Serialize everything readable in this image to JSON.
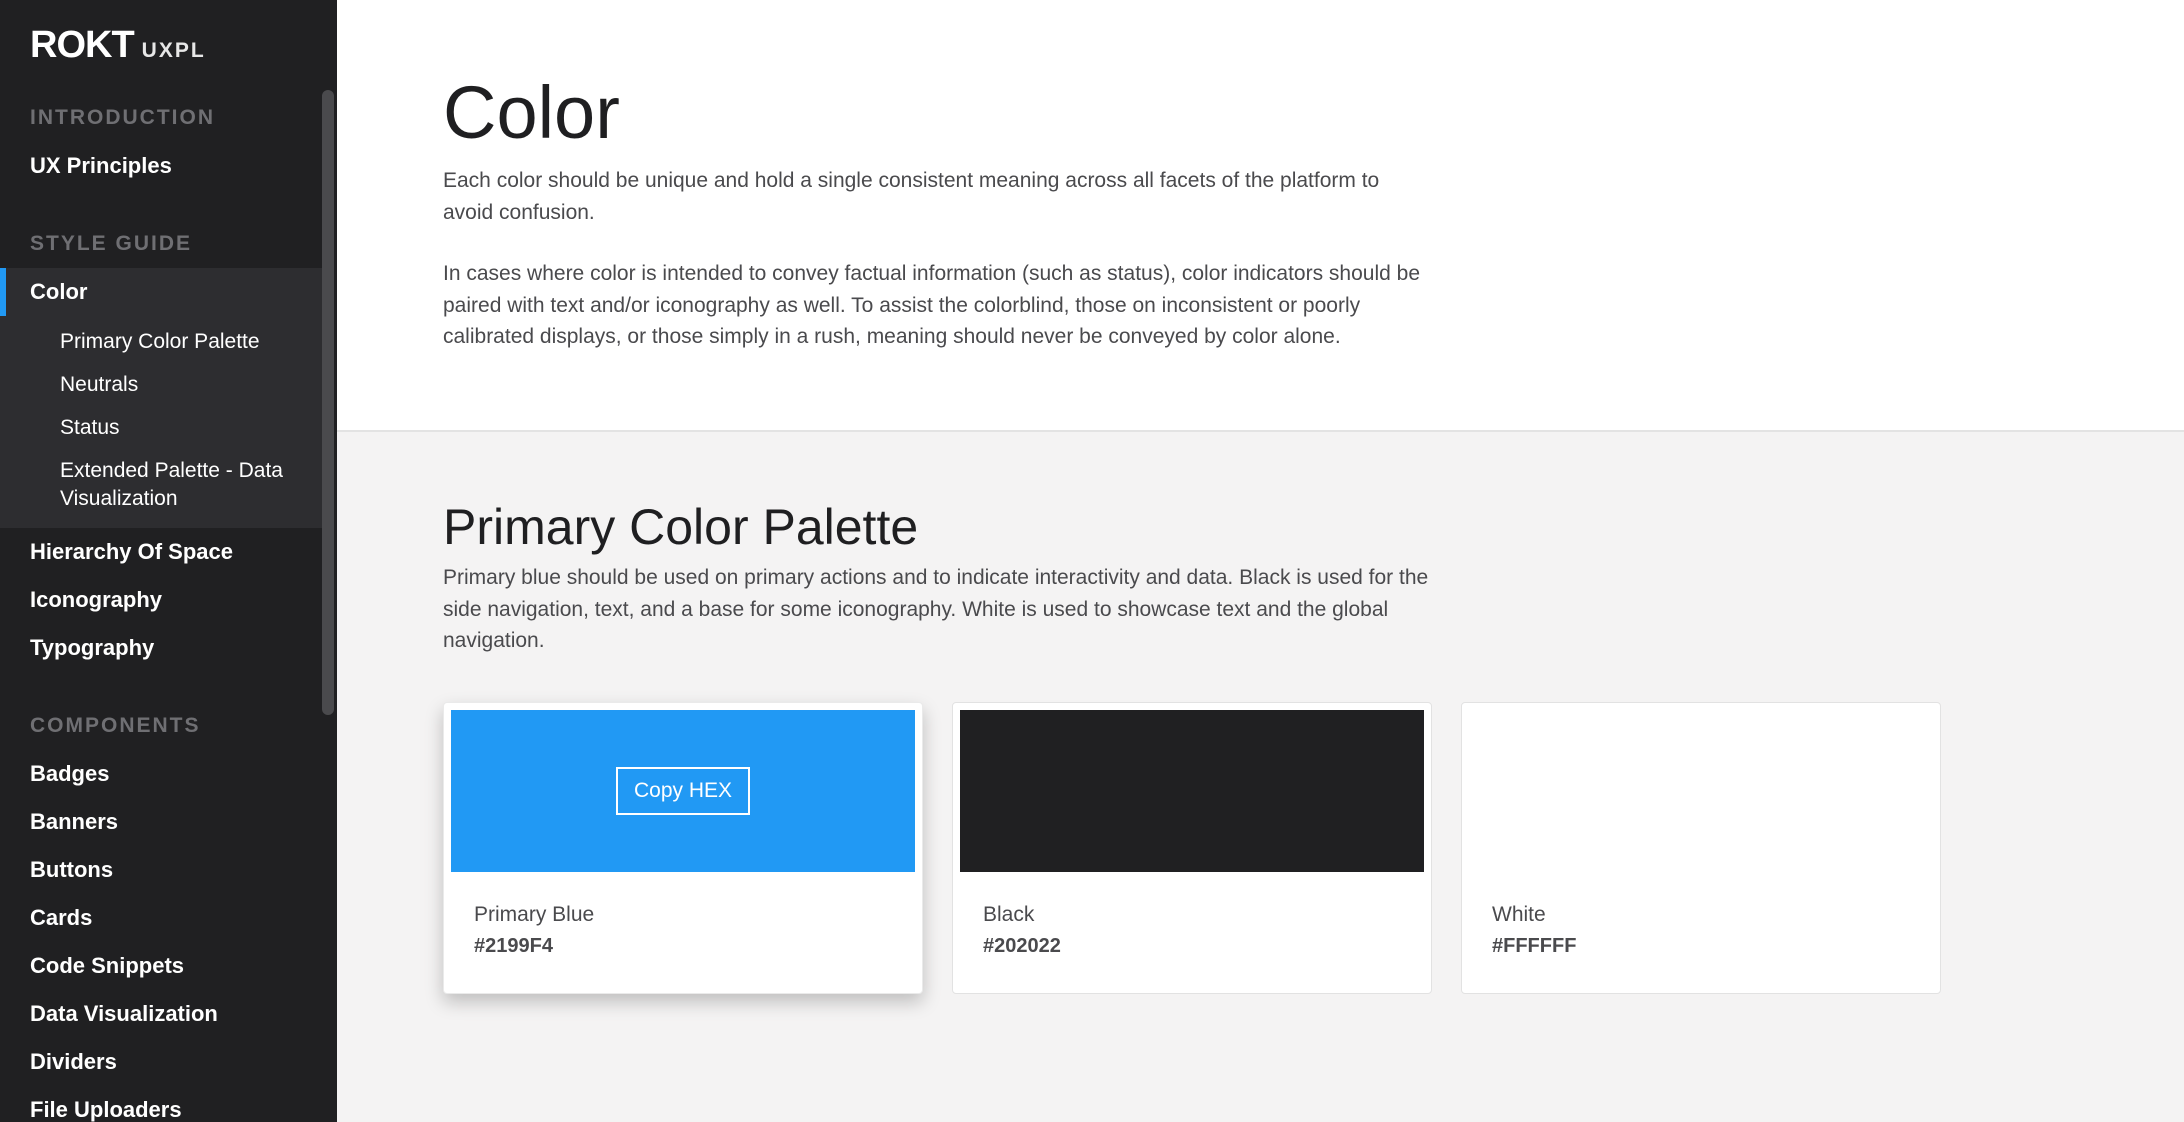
{
  "brand": {
    "logo": "ROKT",
    "sub": "UXPL"
  },
  "sidebar": {
    "intro_header": "INTRODUCTION",
    "ux_principles": "UX Principles",
    "style_header": "STYLE GUIDE",
    "color": "Color",
    "color_sub": [
      "Primary Color Palette",
      "Neutrals",
      "Status",
      "Extended Palette - Data Visualization"
    ],
    "hierarchy": "Hierarchy Of Space",
    "iconography": "Iconography",
    "typography": "Typography",
    "components_header": "COMPONENTS",
    "components": [
      "Badges",
      "Banners",
      "Buttons",
      "Cards",
      "Code Snippets",
      "Data Visualization",
      "Dividers",
      "File Uploaders"
    ]
  },
  "main": {
    "title": "Color",
    "intro_p1": "Each color should be unique and hold a single consistent meaning across all facets of the platform to avoid confusion.",
    "intro_p2": "In cases where color is intended to convey factual information (such as status), color indicators should be paired with text and/or iconography as well. To assist the colorblind, those on inconsistent or poorly calibrated displays, or those simply in a rush, meaning should never be conveyed by color alone."
  },
  "palette": {
    "title": "Primary Color Palette",
    "description": "Primary blue should be used on primary actions and to indicate interactivity and data. Black is used for the side navigation, text, and a base for some iconography. White is used to showcase text and the global navigation.",
    "copy_label": "Copy HEX",
    "cards": [
      {
        "name": "Primary Blue",
        "hex": "#2199F4",
        "color": "#2199F4"
      },
      {
        "name": "Black",
        "hex": "#202022",
        "color": "#202022"
      },
      {
        "name": "White",
        "hex": "#FFFFFF",
        "color": "#FFFFFF"
      }
    ]
  },
  "colors": {
    "accent": "#2199f4",
    "sidebar_bg": "#202022",
    "page_bg": "#f4f3f3"
  }
}
